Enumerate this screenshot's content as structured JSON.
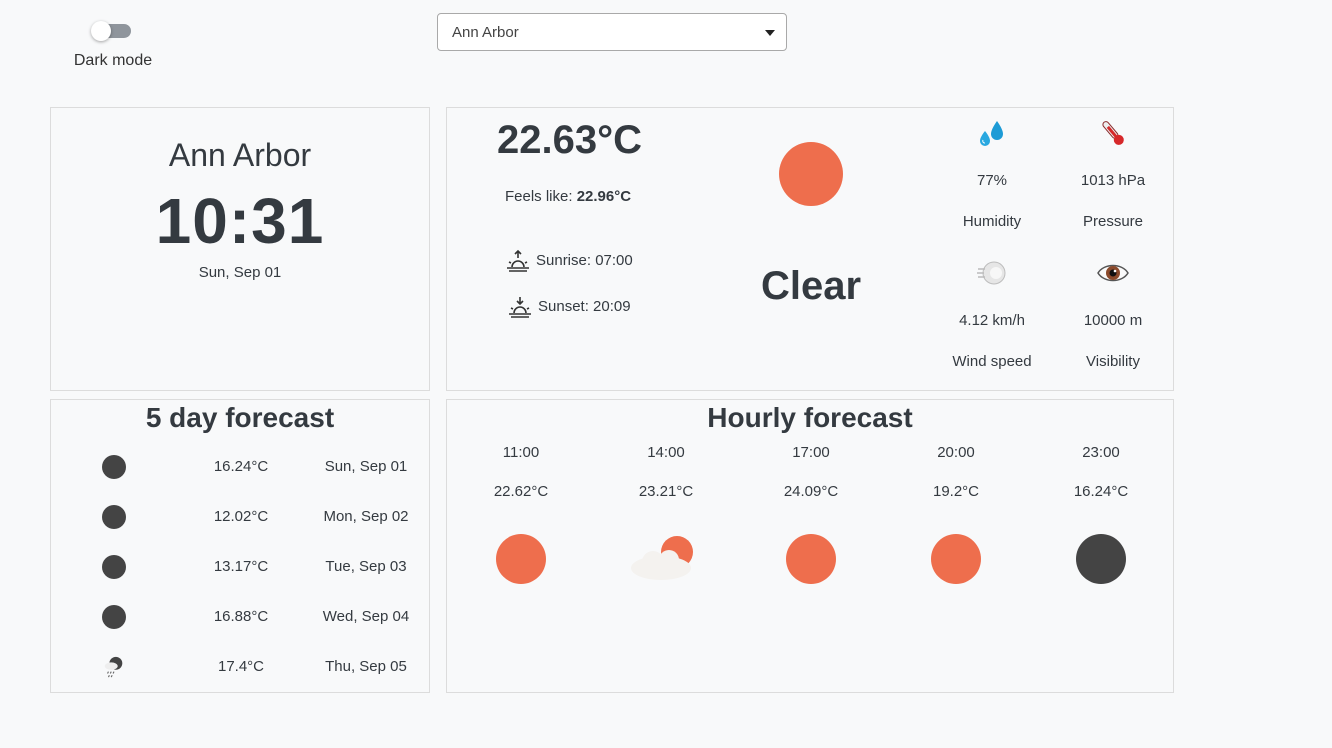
{
  "dark_mode": {
    "label": "Dark mode",
    "enabled": false
  },
  "city_select": {
    "selected": "Ann Arbor"
  },
  "clock": {
    "city": "Ann Arbor",
    "time": "10:31",
    "date": "Sun, Sep 01"
  },
  "current": {
    "temperature": "22.63°C",
    "feels_like_label": "Feels like:",
    "feels_like_value": "22.96°C",
    "sunrise": "Sunrise: 07:00",
    "sunset": "Sunset: 20:09",
    "condition": "Clear",
    "condition_icon": "sun-icon",
    "stats": {
      "humidity": {
        "value": "77%",
        "label": "Humidity",
        "icon": "droplets-icon"
      },
      "pressure": {
        "value": "1013 hPa",
        "label": "Pressure",
        "icon": "thermometer-icon"
      },
      "wind": {
        "value": "4.12 km/h",
        "label": "Wind speed",
        "icon": "wind-icon"
      },
      "visibility": {
        "value": "10000 m",
        "label": "Visibility",
        "icon": "eye-icon"
      }
    }
  },
  "five_day": {
    "title": "5 day forecast",
    "days": [
      {
        "temp": "16.24°C",
        "date": "Sun, Sep 01",
        "icon": "moon-icon"
      },
      {
        "temp": "12.02°C",
        "date": "Mon, Sep 02",
        "icon": "moon-icon"
      },
      {
        "temp": "13.17°C",
        "date": "Tue, Sep 03",
        "icon": "moon-icon"
      },
      {
        "temp": "16.88°C",
        "date": "Wed, Sep 04",
        "icon": "moon-icon"
      },
      {
        "temp": "17.4°C",
        "date": "Thu, Sep 05",
        "icon": "rain-night-icon"
      }
    ]
  },
  "hourly": {
    "title": "Hourly forecast",
    "hours": [
      {
        "time": "11:00",
        "temp": "22.62°C",
        "icon": "sun-icon"
      },
      {
        "time": "14:00",
        "temp": "23.21°C",
        "icon": "partly-cloudy-icon"
      },
      {
        "time": "17:00",
        "temp": "24.09°C",
        "icon": "sun-icon"
      },
      {
        "time": "20:00",
        "temp": "19.2°C",
        "icon": "sun-icon"
      },
      {
        "time": "23:00",
        "temp": "16.24°C",
        "icon": "moon-icon"
      }
    ]
  },
  "colors": {
    "sun": "#ee6e4d",
    "moon": "#444444",
    "text": "#343a40",
    "panel_border": "#dcdcdc"
  }
}
